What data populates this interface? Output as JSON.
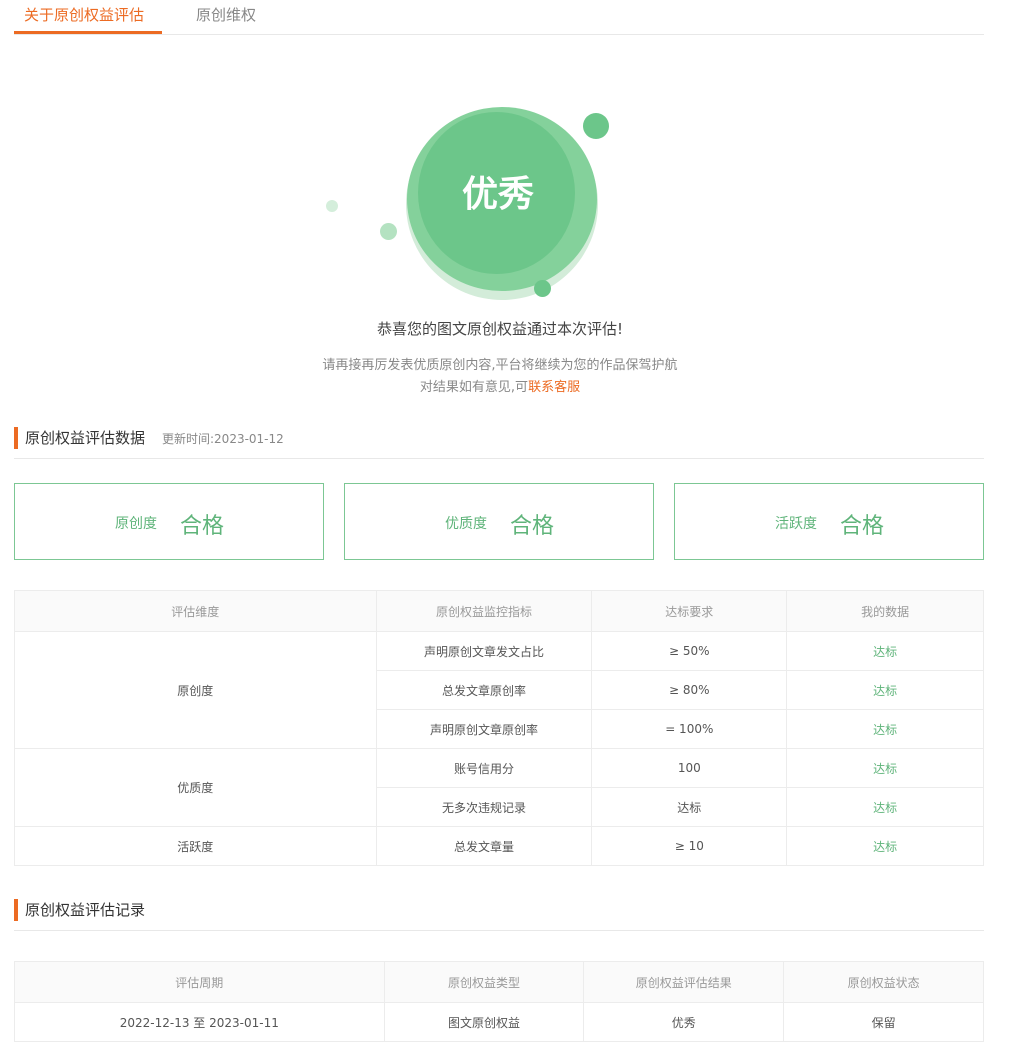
{
  "tabs": [
    {
      "label": "关于原创权益评估",
      "active": true
    },
    {
      "label": "原创维权",
      "active": false
    }
  ],
  "hero": {
    "grade": "优秀",
    "congrats": "恭喜您的图文原创权益通过本次评估!",
    "tip_line1": "请再接再厉发表优质原创内容,平台将继续为您的作品保驾护航",
    "tip_line2_prefix": "对结果如有意见,可",
    "contact_link": "联系客服"
  },
  "data_section": {
    "title": "原创权益评估数据",
    "update_time": "更新时间:2023-01-12"
  },
  "cards": [
    {
      "label": "原创度",
      "value": "合格"
    },
    {
      "label": "优质度",
      "value": "合格"
    },
    {
      "label": "活跃度",
      "value": "合格"
    }
  ],
  "metrics_table": {
    "headers": [
      "评估维度",
      "原创权益监控指标",
      "达标要求",
      "我的数据"
    ],
    "groups": [
      {
        "dimension": "原创度",
        "rows": [
          {
            "metric": "声明原创文章发文占比",
            "req": "≥ 50%",
            "mine": "达标"
          },
          {
            "metric": "总发文章原创率",
            "req": "≥ 80%",
            "mine": "达标"
          },
          {
            "metric": "声明原创文章原创率",
            "req": "= 100%",
            "mine": "达标"
          }
        ]
      },
      {
        "dimension": "优质度",
        "rows": [
          {
            "metric": "账号信用分",
            "req": "100",
            "mine": "达标"
          },
          {
            "metric": "无多次违规记录",
            "req": "达标",
            "mine": "达标"
          }
        ]
      },
      {
        "dimension": "活跃度",
        "rows": [
          {
            "metric": "总发文章量",
            "req": "≥ 10",
            "mine": "达标"
          }
        ]
      }
    ]
  },
  "record_section": {
    "title": "原创权益评估记录"
  },
  "record_table": {
    "headers": [
      "评估周期",
      "原创权益类型",
      "原创权益评估结果",
      "原创权益状态"
    ],
    "rows": [
      {
        "period": "2022-12-13 至 2023-01-11",
        "type": "图文原创权益",
        "result": "优秀",
        "status": "保留"
      }
    ]
  },
  "colors": {
    "accent": "#ec6b23",
    "success": "#5fb47a",
    "bubble": "#6cc68a"
  }
}
